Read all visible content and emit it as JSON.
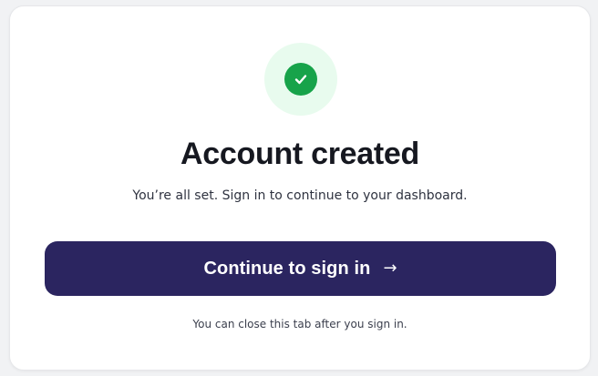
{
  "card": {
    "title": "Account created",
    "subtitle": "You’re all set. Sign in to continue to your dashboard.",
    "note": "You can close this tab after you sign in."
  },
  "cta": {
    "label": "Continue to sign in",
    "arrow": "→"
  },
  "icons": {
    "status": "check-circle-icon",
    "cta": "arrow-right-icon"
  },
  "colors": {
    "accent": "#2b2560",
    "success": "#17a34a",
    "success_bg": "#e8fbee",
    "text": "#161820"
  }
}
